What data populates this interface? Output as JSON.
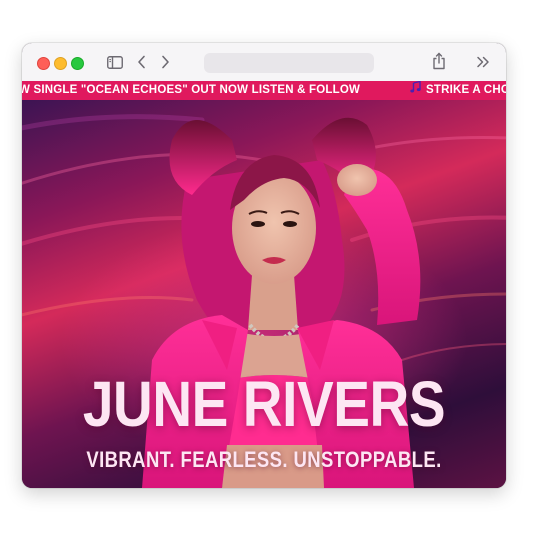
{
  "browser": {
    "window_controls": [
      "close",
      "minimize",
      "maximize"
    ],
    "toolbar_icons": [
      "sidebar-icon",
      "back-icon",
      "forward-icon",
      "share-icon",
      "more-icon"
    ],
    "address": ""
  },
  "ticker": {
    "items": [
      {
        "text": "W SINGLE \"OCEAN ECHOES\" OUT NOW LISTEN & FOLLOW"
      },
      {
        "icon": "music-note-icon",
        "text": "STRIKE A CHO"
      }
    ],
    "color": "#e0195e"
  },
  "hero": {
    "title": "JUNE RIVERS",
    "tagline": "VIBRANT. FEARLESS. UNSTOPPABLE.",
    "image": "portrait-photo",
    "accent": "#ff1f8e",
    "text_color": "#fde6f3"
  }
}
